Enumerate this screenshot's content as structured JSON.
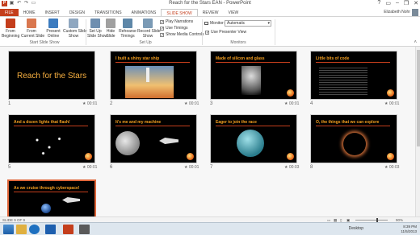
{
  "window": {
    "title": "Reach for the Stars EAN - PowerPoint",
    "user": "Elizabeth Nohr"
  },
  "tabs": [
    "FILE",
    "HOME",
    "INSERT",
    "DESIGN",
    "TRANSITIONS",
    "ANIMATIONS",
    "SLIDE SHOW",
    "REVIEW",
    "VIEW"
  ],
  "ribbon": {
    "start": {
      "from_beginning": "From\nBeginning",
      "from_current": "From\nCurrent Slide",
      "present_online": "Present\nOnline",
      "custom_show": "Custom Slide\nShow",
      "label": "Start Slide Show"
    },
    "setup": {
      "set_up": "Set Up\nSlide Show",
      "hide": "Hide\nSlide",
      "rehearse": "Rehearse\nTimings",
      "record": "Record Slide\nShow",
      "play_narrations": "Play Narrations",
      "use_timings": "Use Timings",
      "show_media_controls": "Show Media Controls",
      "label": "Set Up"
    },
    "monitors": {
      "monitor_label": "Monitor:",
      "monitor_value": "Automatic",
      "use_presenter_view": "Use Presenter View",
      "label": "Monitors"
    }
  },
  "slides": [
    {
      "num": "1",
      "title": "Reach for the Stars",
      "time": "00:01",
      "style": "big"
    },
    {
      "num": "2",
      "title": "I built a shiny star ship",
      "time": "00:01",
      "style": "rocket"
    },
    {
      "num": "3",
      "title": "Made of silicon and glass",
      "time": "00:01",
      "style": "astro"
    },
    {
      "num": "4",
      "title": "Little bits of code",
      "time": "00:01",
      "style": "code"
    },
    {
      "num": "5",
      "title": "And a dozen lights that flash!",
      "time": "00:01",
      "style": "lights"
    },
    {
      "num": "6",
      "title": "It's me and my machine",
      "time": "00:01",
      "style": "moon"
    },
    {
      "num": "7",
      "title": "Eager to join the race",
      "time": "00:03",
      "style": "planet"
    },
    {
      "num": "8",
      "title": "O, the things that we can explore",
      "time": "00:03",
      "style": "eclipse"
    },
    {
      "num": "9",
      "title": "As we cruise through cyberspace!",
      "time": "",
      "style": "earth"
    }
  ],
  "status": {
    "slide_indicator": "SLIDE 9 OF 9",
    "zoom": "90%"
  },
  "taskbar": {
    "desktop": "Desktop",
    "time": "8:39 PM",
    "date": "11/5/2013"
  },
  "colors": {
    "accent": "#c43e1c",
    "title_text": "#f6a020",
    "selected_border": "#e0663a"
  }
}
